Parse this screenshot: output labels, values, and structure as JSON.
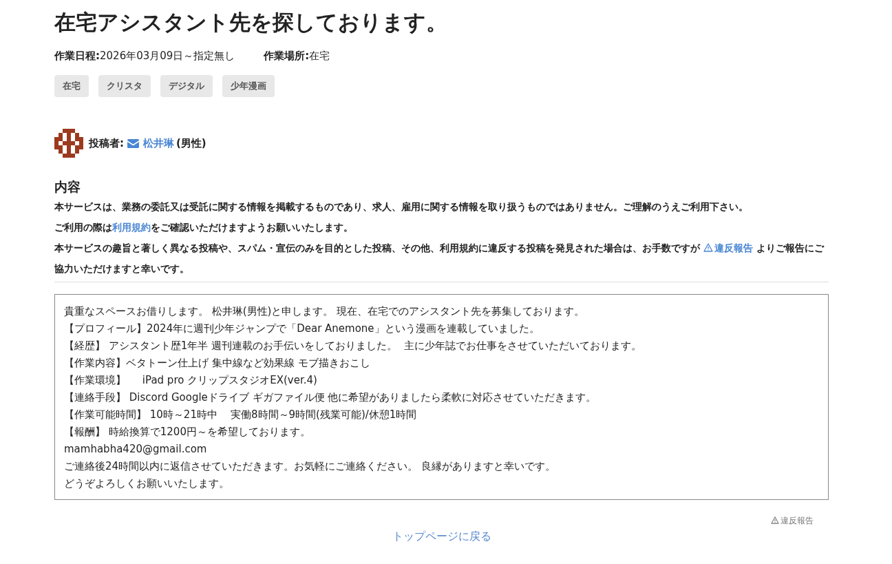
{
  "title": "在宅アシスタント先を探しております。",
  "meta": [
    {
      "label": "作業日程:",
      "value": "2026年03月09日～指定無し"
    },
    {
      "label": "作業場所:",
      "value": "在宅"
    }
  ],
  "tags": [
    "在宅",
    "クリスタ",
    "デジタル",
    "少年漫画"
  ],
  "poster": {
    "label": "投稿者:",
    "name": "松井琳",
    "gender": "(男性)"
  },
  "section_heading": "内容",
  "notice": [
    {
      "before": "本サービスは、業務の委託又は受託に関する情報を掲載するものであり、求人、雇用に関する情報を取り扱うものではありません。ご理解のうえご利用下さい。"
    },
    {
      "before": "ご利用の際は",
      "link": {
        "text": "利用規約",
        "kind": "plain"
      },
      "after": "をご確認いただけますようお願いいたします。"
    },
    {
      "before": "本サービスの趣旨と著しく異なる投稿や、スパム・宣伝のみを目的とした投稿、その他、利用規約に違反する投稿を発見された場合は、お手数ですが ",
      "link": {
        "text": "違反報告",
        "kind": "report"
      },
      "after": " よりご報告にご協力いただけますと幸いです。"
    }
  ],
  "body": [
    "貴重なスペースお借りします。 松井琳(男性)と申します。 現在、在宅でのアシスタント先を募集しております。",
    "【プロフィール】2024年に週刊少年ジャンプで「Dear Anemone」という漫画を連載していました。",
    "【経歴】 アシスタント歴1年半 週刊連載のお手伝いをしておりました。  主に少年誌でお仕事をさせていただいております。",
    "【作業内容】ベタトーン仕上げ 集中線など効果線 モブ描きおこし",
    "【作業環境】     iPad pro クリップスタジオEX(ver.4)",
    "【連絡手段】 Discord Googleドライブ ギガファイル便 他に希望がありましたら柔軟に対応させていただきます。",
    "【作業可能時間】 10時～21時中    実働8時間～9時間(残業可能)/休憩1時間",
    "【報酬】 時給換算で1200円～を希望しております。",
    "mamhabha420@gmail.com",
    "ご連絡後24時間以内に返信させていただきます。お気軽にご連絡ください。 良縁がありますと幸いです。",
    "どうぞよろしくお願いいたします。"
  ],
  "report_link": "違反報告",
  "back_link": "トップページに戻る"
}
